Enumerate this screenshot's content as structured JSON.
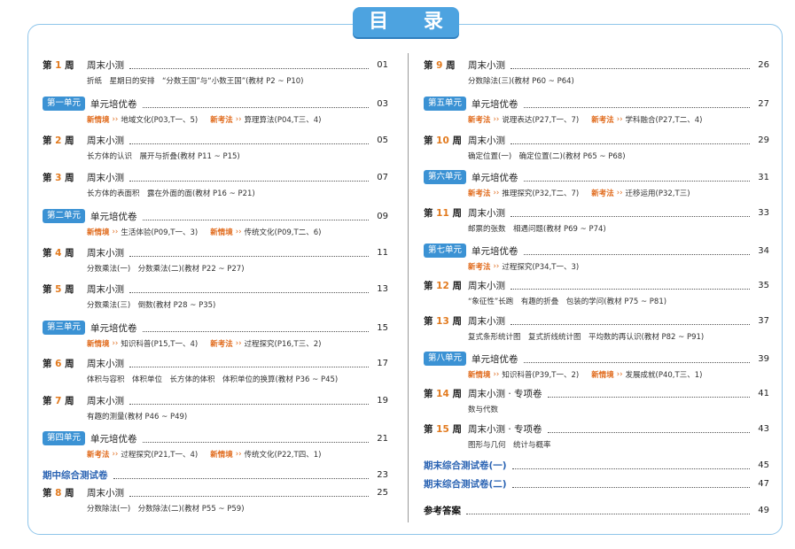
{
  "title": "目 录",
  "colors": {
    "accent": "#4da3e0",
    "orange": "#e06a1b",
    "blue_text": "#2a63b3"
  },
  "left": [
    {
      "type": "week",
      "pre": "第",
      "num": "1",
      "post": "周",
      "label": "周末小测",
      "page": "01",
      "sub": "折纸　星期日的安排　“分数王国”与“小数王国”(教材 P2 ~ P10)"
    },
    {
      "type": "unit",
      "badge": "第一单元",
      "label": "单元培优卷",
      "page": "03",
      "tags": [
        {
          "tag": "新情境",
          "text": "地域文化(P03,T一、5)"
        },
        {
          "tag": "新考法",
          "text": "算理算法(P04,T三、4)"
        }
      ]
    },
    {
      "type": "week",
      "pre": "第",
      "num": "2",
      "post": "周",
      "label": "周末小测",
      "page": "05",
      "sub": "长方体的认识　展开与折叠(教材 P11 ~ P15)"
    },
    {
      "type": "week",
      "pre": "第",
      "num": "3",
      "post": "周",
      "label": "周末小测",
      "page": "07",
      "sub": "长方体的表面积　露在外面的面(教材 P16 ~ P21)"
    },
    {
      "type": "unit",
      "badge": "第二单元",
      "label": "单元培优卷",
      "page": "09",
      "tags": [
        {
          "tag": "新情境",
          "text": "生活体验(P09,T一、3)"
        },
        {
          "tag": "新情境",
          "text": "传统文化(P09,T二、6)"
        }
      ]
    },
    {
      "type": "week",
      "pre": "第",
      "num": "4",
      "post": "周",
      "label": "周末小测",
      "page": "11",
      "sub": "分数乘法(一)　分数乘法(二)(教材 P22 ~ P27)"
    },
    {
      "type": "week",
      "pre": "第",
      "num": "5",
      "post": "周",
      "label": "周末小测",
      "page": "13",
      "sub": "分数乘法(三)　倒数(教材 P28 ~ P35)"
    },
    {
      "type": "unit",
      "badge": "第三单元",
      "label": "单元培优卷",
      "page": "15",
      "tags": [
        {
          "tag": "新情境",
          "text": "知识科普(P15,T一、4)"
        },
        {
          "tag": "新考法",
          "text": "过程探究(P16,T三、2)"
        }
      ]
    },
    {
      "type": "week",
      "pre": "第",
      "num": "6",
      "post": "周",
      "label": "周末小测",
      "page": "17",
      "sub": "体积与容积　体积单位　长方体的体积　体积单位的换算(教材 P36 ~ P45)"
    },
    {
      "type": "week",
      "pre": "第",
      "num": "7",
      "post": "周",
      "label": "周末小测",
      "page": "19",
      "sub": "有趣的测量(教材 P46 ~ P49)"
    },
    {
      "type": "unit",
      "badge": "第四单元",
      "label": "单元培优卷",
      "page": "21",
      "tags": [
        {
          "tag": "新考法",
          "text": "过程探究(P21,T一、4)"
        },
        {
          "tag": "新情境",
          "text": "传统文化(P22,T四、1)"
        }
      ]
    },
    {
      "type": "special",
      "label": "期中综合测试卷",
      "page": "23"
    },
    {
      "type": "week",
      "pre": "第",
      "num": "8",
      "post": "周",
      "label": "周末小测",
      "page": "25",
      "sub": "分数除法(一)　分数除法(二)(教材 P55 ~ P59)"
    }
  ],
  "right": [
    {
      "type": "week",
      "pre": "第",
      "num": "9",
      "post": "周",
      "label": "周末小测",
      "page": "26",
      "sub": "分数除法(三)(教材 P60 ~ P64)"
    },
    {
      "type": "unit",
      "badge": "第五单元",
      "label": "单元培优卷",
      "page": "27",
      "tags": [
        {
          "tag": "新考法",
          "text": "说理表达(P27,T一、7)"
        },
        {
          "tag": "新考法",
          "text": "学科融合(P27,T二、4)"
        }
      ]
    },
    {
      "type": "week",
      "pre": "第",
      "num": "10",
      "post": "周",
      "label": "周末小测",
      "page": "29",
      "sub": "确定位置(一)　确定位置(二)(教材 P65 ~ P68)"
    },
    {
      "type": "unit",
      "badge": "第六单元",
      "label": "单元培优卷",
      "page": "31",
      "tags": [
        {
          "tag": "新考法",
          "text": "推理探究(P32,T二、7)"
        },
        {
          "tag": "新考法",
          "text": "迁移运用(P32,T三)"
        }
      ]
    },
    {
      "type": "week",
      "pre": "第",
      "num": "11",
      "post": "周",
      "label": "周末小测",
      "page": "33",
      "sub": "邮票的张数　相遇问题(教材 P69 ~ P74)"
    },
    {
      "type": "unit",
      "badge": "第七单元",
      "label": "单元培优卷",
      "page": "34",
      "tags": [
        {
          "tag": "新考法",
          "text": "过程探究(P34,T一、3)"
        }
      ]
    },
    {
      "type": "week",
      "pre": "第",
      "num": "12",
      "post": "周",
      "label": "周末小测",
      "page": "35",
      "sub": "“象征性”长跑　有趣的折叠　包装的学问(教材 P75 ~ P81)"
    },
    {
      "type": "week",
      "pre": "第",
      "num": "13",
      "post": "周",
      "label": "周末小测",
      "page": "37",
      "sub": "复式条形统计图　复式折线统计图　平均数的再认识(教材 P82 ~ P91)"
    },
    {
      "type": "unit",
      "badge": "第八单元",
      "label": "单元培优卷",
      "page": "39",
      "tags": [
        {
          "tag": "新情境",
          "text": "知识科普(P39,T一、2)"
        },
        {
          "tag": "新情境",
          "text": "发展成就(P40,T三、1)"
        }
      ]
    },
    {
      "type": "week",
      "pre": "第",
      "num": "14",
      "post": "周",
      "label": "周末小测 · 专项卷",
      "page": "41",
      "sub": "数与代数"
    },
    {
      "type": "week",
      "pre": "第",
      "num": "15",
      "post": "周",
      "label": "周末小测 · 专项卷",
      "page": "43",
      "sub": "图形与几何　统计与概率"
    },
    {
      "type": "special",
      "label": "期末综合测试卷(一)",
      "page": "45"
    },
    {
      "type": "special",
      "label": "期末综合测试卷(二)",
      "page": "47"
    },
    {
      "type": "answers",
      "label": "参考答案",
      "page": "49"
    }
  ]
}
